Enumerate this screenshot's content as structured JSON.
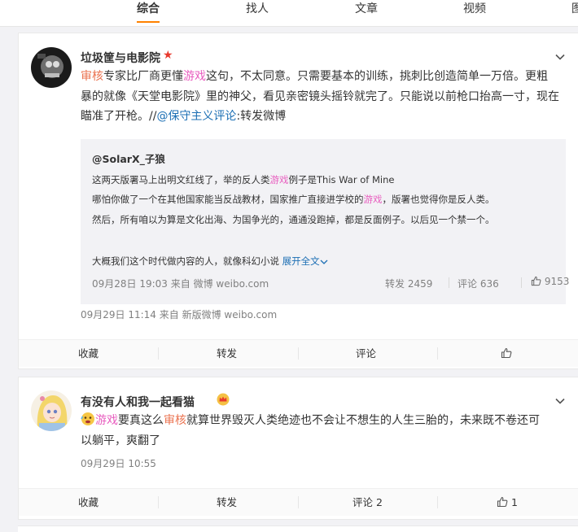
{
  "tabs": [
    "综合",
    "找人",
    "文章",
    "视频",
    "图"
  ],
  "post1": {
    "username": "垃圾筐与电影院",
    "badge": "★",
    "text": {
      "l1a": "审核",
      "l1b": "专家比厂商更懂",
      "l1c": "游戏",
      "l1d": "这句，不太同意。只需要基本的训练，挑刺比创造简单一万倍。更粗",
      "l2": "暴的就像《天堂电影院》里的神父，看见亲密镜头摇铃就完了。只能说以前枪口抬高一寸，现在",
      "l3a": "瞄准了开枪。//",
      "l3b": "@保守主义评论",
      "l3c": ":转发微博"
    },
    "repost": {
      "user": "@SolarX_子狼",
      "l1a": "这两天版署马上出明文红线了，举的反人类",
      "l1b": "游戏",
      "l1c": "例子是This War of Mine",
      "l2a": "哪怕你做了一个在其他国家能当反战教材，国家推广直接进学校的",
      "l2b": "游戏",
      "l2c": "，版署也觉得你是反人类。",
      "l3": "然后，所有咱以为算是文化出海、为国争光的，通通没跑掉，都是反面例子。以后见一个禁一个。",
      "l4": "大概我们这个时代做内容的人，就像科幻小说",
      "expand": "展开全文",
      "time": "09月28日 19:03",
      "from_label": "来自",
      "source": "微博 weibo.com",
      "repost_label": "转发 2459",
      "comment_label": "评论 636",
      "like_count": "9153"
    },
    "time": "09月29日 11:14",
    "from_label": "来自",
    "source": "新版微博 weibo.com",
    "actions": {
      "favorite": "收藏",
      "repost": "转发",
      "comment": "评论"
    }
  },
  "post2": {
    "username": "有没有人和我一起看猫",
    "text": {
      "l1a": "游戏",
      "l1b": "要真这么",
      "l1c": "审核",
      "l1d": "就算世界毁灭人类绝迹也不会让不想生的人生三胎的，未来既不卷还可",
      "l2": "以躺平，爽翻了"
    },
    "time": "09月29日 10:55",
    "actions": {
      "favorite": "收藏",
      "repost": "转发",
      "comment": "评论 2",
      "like": "1"
    }
  },
  "colors": {
    "accent": "#ff8200",
    "highlight": "#eb7350",
    "link": "#1c6fb4",
    "keyword": "#e85dbf"
  },
  "icons": [
    "chevron-down-icon",
    "thumbs-up-icon",
    "star-badge-icon",
    "crown-badge-icon",
    "emoji-icon"
  ]
}
